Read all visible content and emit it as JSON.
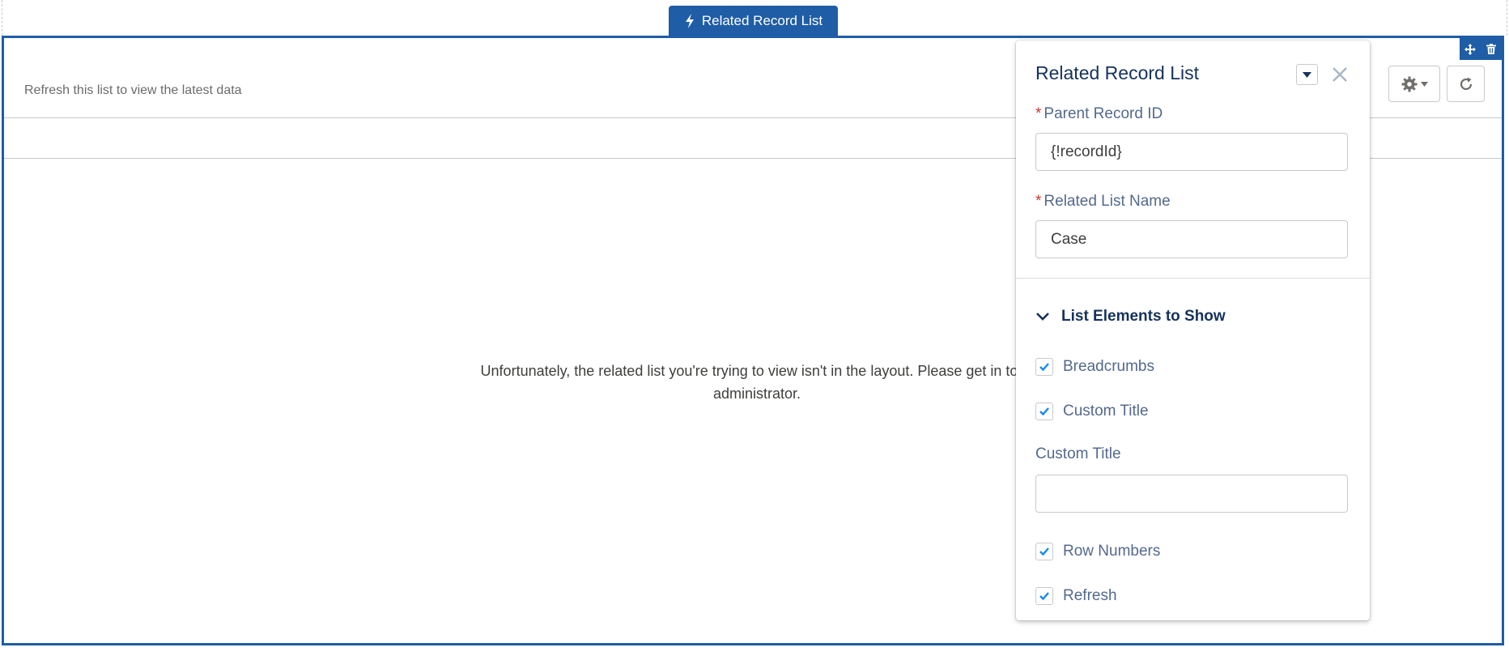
{
  "component_tab": {
    "label": "Related Record List",
    "icon": "lightning-bolt-icon"
  },
  "frame_tools": {
    "move_icon": "move-icon",
    "delete_icon": "trash-icon"
  },
  "list": {
    "refresh_hint": "Refresh this list to view the latest data",
    "message": "Unfortunately, the related list you're trying to view isn't in the layout. Please get in touc",
    "message_line2": "administrator.",
    "settings_icon": "gear-icon",
    "refresh_icon": "refresh-icon"
  },
  "panel": {
    "title": "Related Record List",
    "fields": {
      "parent_record_id": {
        "label": "Parent Record ID",
        "required_mark": "*",
        "value": "{!recordId}"
      },
      "related_list_name": {
        "label": "Related List Name",
        "required_mark": "*",
        "value": "Case"
      }
    },
    "section": {
      "label": "List Elements to Show",
      "expanded": true
    },
    "checkboxes": {
      "breadcrumbs": {
        "label": "Breadcrumbs",
        "checked": true
      },
      "custom_title": {
        "label": "Custom Title",
        "checked": true
      },
      "row_numbers": {
        "label": "Row Numbers",
        "checked": true
      },
      "refresh": {
        "label": "Refresh",
        "checked": true
      }
    },
    "custom_title_field": {
      "label": "Custom Title",
      "value": ""
    }
  },
  "colors": {
    "brand": "#1f5da6",
    "check": "#1589ee",
    "title": "#16325c"
  }
}
